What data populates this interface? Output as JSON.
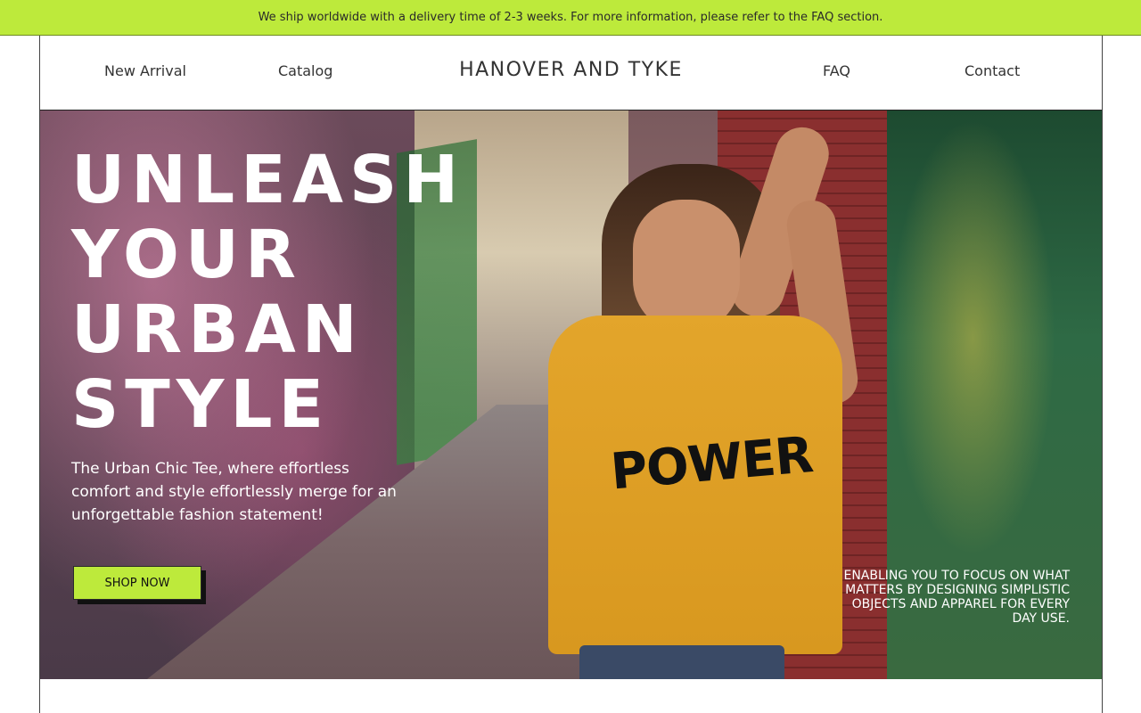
{
  "announcement": {
    "text": "We ship worldwide with a delivery time of 2-3 weeks. For more information, please refer to the FAQ section."
  },
  "nav": {
    "new_arrival": "New Arrival",
    "catalog": "Catalog",
    "brand": "HANOVER AND TYKE",
    "faq": "FAQ",
    "contact": "Contact"
  },
  "hero": {
    "headline_lines": [
      "UNLEASH",
      "YOUR",
      "URBAN",
      "STYLE"
    ],
    "subtext": "The Urban Chic Tee, where effortless comfort and style effortlessly merge for an unforgettable fashion statement!",
    "cta": "SHOP NOW",
    "tagline": "ENABLING YOU TO FOCUS ON WHAT MATTERS BY DESIGNING SIMPLISTIC OBJECTS AND APPAREL FOR EVERY DAY USE.",
    "shirt_print": "POWER"
  },
  "colors": {
    "accent": "#bdea3b",
    "shirt": "#e3a52b"
  }
}
